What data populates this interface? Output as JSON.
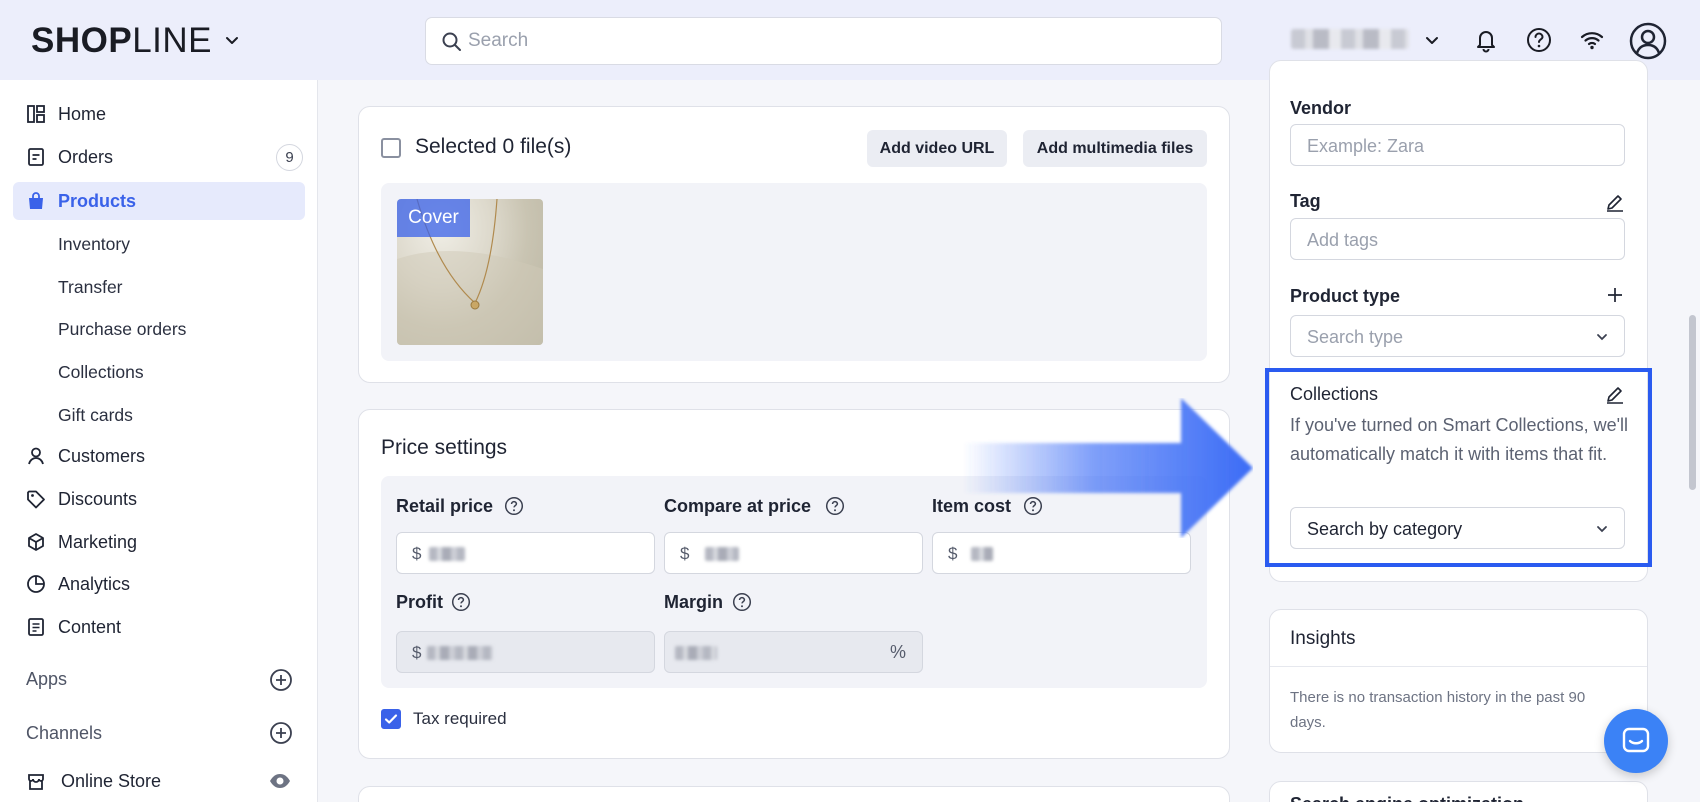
{
  "topbar": {
    "logo_bold": "SHOP",
    "logo_thin": "LINE",
    "search_placeholder": "Search",
    "icons": [
      "chevron-down-icon",
      "bell-icon",
      "help-icon",
      "wifi-icon",
      "avatar-icon"
    ]
  },
  "sidebar": {
    "items": [
      {
        "label": "Home",
        "icon": "home-icon"
      },
      {
        "label": "Orders",
        "icon": "orders-icon",
        "badge": "9"
      },
      {
        "label": "Products",
        "icon": "bag-icon",
        "active": true
      },
      {
        "label": "Customers",
        "icon": "person-icon"
      },
      {
        "label": "Discounts",
        "icon": "tag-icon"
      },
      {
        "label": "Marketing",
        "icon": "cube-icon"
      },
      {
        "label": "Analytics",
        "icon": "pie-icon"
      },
      {
        "label": "Content",
        "icon": "document-icon"
      }
    ],
    "sub_items": [
      "Inventory",
      "Transfer",
      "Purchase orders",
      "Collections",
      "Gift cards"
    ],
    "apps_label": "Apps",
    "channels_label": "Channels",
    "online_store_label": "Online Store"
  },
  "media": {
    "selected_label": "Selected 0 file(s)",
    "add_video_label": "Add video URL",
    "add_multimedia_label": "Add multimedia files",
    "cover_label": "Cover"
  },
  "price": {
    "title": "Price settings",
    "retail_label": "Retail price",
    "compare_label": "Compare at price",
    "cost_label": "Item cost",
    "profit_label": "Profit",
    "margin_label": "Margin",
    "currency": "$",
    "percent": "%",
    "tax_label": "Tax required",
    "tax_checked": true
  },
  "organization": {
    "vendor_label": "Vendor",
    "vendor_placeholder": "Example: Zara",
    "tag_label": "Tag",
    "tag_placeholder": "Add tags",
    "type_label": "Product type",
    "type_placeholder": "Search type",
    "collections_label": "Collections",
    "collections_desc": "If you've turned on Smart Collections, we'll automatically match it with items that fit.",
    "collections_select": "Search by category"
  },
  "insights": {
    "title": "Insights",
    "text": "There is no transaction history in the past 90 days."
  },
  "seo": {
    "title": "Search engine optimization"
  },
  "colors": {
    "accent": "#3a62e9",
    "highlight": "#2a5bf0",
    "topbar": "#eceefb"
  }
}
